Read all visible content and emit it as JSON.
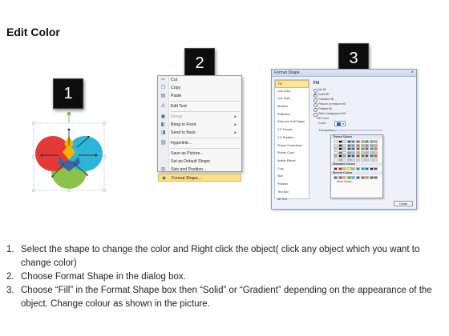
{
  "title": "Edit Color",
  "badges": [
    "1",
    "2",
    "3"
  ],
  "context_menu": {
    "items": [
      {
        "label": "Cut",
        "icon": "scissors-icon",
        "glyph": "✂",
        "disabled": false,
        "submenu": false
      },
      {
        "label": "Copy",
        "icon": "copy-icon",
        "glyph": "❐",
        "disabled": false,
        "submenu": false
      },
      {
        "label": "Paste",
        "icon": "paste-icon",
        "glyph": "▤",
        "disabled": false,
        "submenu": false
      },
      {
        "label": "Edit Text",
        "icon": "edit-text-icon",
        "glyph": "A",
        "disabled": false,
        "submenu": false,
        "sep_before": true
      },
      {
        "label": "Group",
        "icon": "group-icon",
        "glyph": "▣",
        "disabled": true,
        "submenu": true,
        "sep_before": true
      },
      {
        "label": "Bring to Front",
        "icon": "bring-front-icon",
        "glyph": "◧",
        "disabled": false,
        "submenu": true
      },
      {
        "label": "Send to Back",
        "icon": "send-back-icon",
        "glyph": "◨",
        "disabled": false,
        "submenu": true
      },
      {
        "label": "Hyperlink...",
        "icon": "hyperlink-icon",
        "glyph": "⛓",
        "disabled": false,
        "submenu": false,
        "sep_before": true
      },
      {
        "label": "Save as Picture...",
        "icon": "",
        "glyph": "",
        "disabled": false,
        "submenu": false,
        "sep_before": true
      },
      {
        "label": "Set as Default Shape",
        "icon": "",
        "glyph": "",
        "disabled": false,
        "submenu": false
      },
      {
        "label": "Size and Position...",
        "icon": "size-position-icon",
        "glyph": "⊞",
        "disabled": false,
        "submenu": false
      },
      {
        "label": "Format Shape...",
        "icon": "format-shape-icon",
        "glyph": "◆",
        "disabled": false,
        "submenu": false,
        "highlighted": true
      }
    ]
  },
  "dialog": {
    "title": "Format Shape",
    "close_glyph": "×",
    "nav": [
      "Fill",
      "Line Color",
      "Line Style",
      "Shadow",
      "Reflection",
      "Glow and Soft Edges",
      "3-D Format",
      "3-D Rotation",
      "Picture Corrections",
      "Picture Color",
      "Artistic Effects",
      "Crop",
      "Size",
      "Position",
      "Text Box",
      "Alt Text"
    ],
    "fill_heading": "Fill",
    "fill_options": [
      {
        "label": "No fill",
        "on": false
      },
      {
        "label": "Solid fill",
        "on": true
      },
      {
        "label": "Gradient fill",
        "on": false
      },
      {
        "label": "Picture or texture fill",
        "on": false
      },
      {
        "label": "Pattern fill",
        "on": false
      },
      {
        "label": "Slide background fill",
        "on": false
      }
    ],
    "fill_color_label": "Fill Color",
    "color_label": "Color:",
    "transparency_label": "Transparency:",
    "close_label": "Close"
  },
  "color_picker": {
    "theme_label": "Theme Colors",
    "standard_label": "Standard Colors",
    "recent_label": "Recent Colors",
    "more_label": "More Colors...",
    "theme_colors": [
      "#ffffff",
      "#000000",
      "#eeece1",
      "#1f497d",
      "#4f81bd",
      "#c0504d",
      "#9bbb59",
      "#8064a2",
      "#4bacc6",
      "#f79646"
    ],
    "standard_colors": [
      "#c00000",
      "#ff0000",
      "#ffc000",
      "#ffff00",
      "#92d050",
      "#00b050",
      "#00b0f0",
      "#0070c0",
      "#002060",
      "#7030a0"
    ],
    "recent_colors": [
      "#3a66a6",
      "#e53935",
      "#fbc02d",
      "#43a047",
      "#26c6da",
      "#8e24aa",
      "#1e88e5",
      "#fb8c00",
      "#6d4c41",
      "#546e7a"
    ]
  },
  "instructions": [
    {
      "num": "1.",
      "text": "Select the shape to change the color and Right click the object( click any object which you want to change color)"
    },
    {
      "num": "2.",
      "text": "Choose Format Shape in the dialog box."
    },
    {
      "num": "3.",
      "text": "Choose “Fill” in the Format Shape box then “Solid” or “Gradient” depending on the appearance of the object. Change colour as shown in the picture."
    }
  ]
}
